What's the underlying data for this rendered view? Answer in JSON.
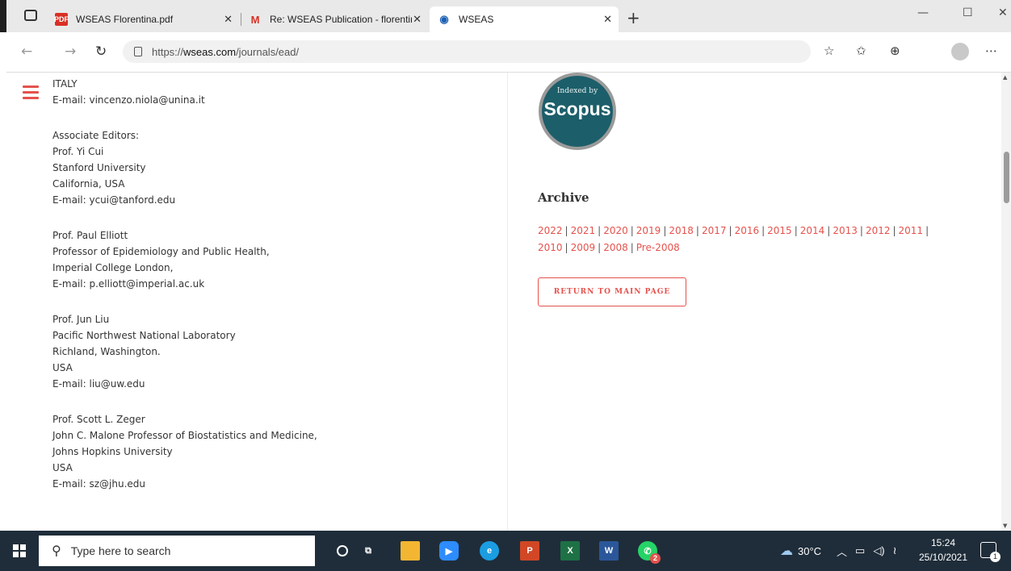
{
  "browser": {
    "tabs": [
      {
        "label": "WSEAS Florentina.pdf",
        "icon": "pdf-icon"
      },
      {
        "label": "Re: WSEAS Publication - florentir",
        "icon": "gmail-icon"
      },
      {
        "label": "WSEAS",
        "icon": "wseas-logo-icon"
      }
    ],
    "url_prefix": "https://",
    "url_domain": "wseas.com",
    "url_path": "/journals/ead/"
  },
  "left": {
    "lines_top": [
      "ITALY",
      "E-mail: vincenzo.niola@unina.it"
    ],
    "assoc_heading": "Associate Editors:",
    "block1": [
      "Prof. Yi Cui",
      "Stanford University",
      "California, USA",
      "E-mail: ycui@tanford.edu"
    ],
    "block2": [
      "Prof. Paul Elliott",
      "Professor of Epidemiology and Public Health,",
      "Imperial College London,",
      "E-mail: p.elliott@imperial.ac.uk"
    ],
    "block3": [
      "Prof. Jun Liu",
      "Pacific Northwest National Laboratory",
      "Richland, Washington.",
      "USA",
      "E-mail: liu@uw.edu"
    ],
    "block4": [
      "Prof. Scott L. Zeger",
      "John C. Malone Professor of Biostatistics and Medicine,",
      "Johns Hopkins University",
      "USA",
      "E-mail: sz@jhu.edu"
    ]
  },
  "right": {
    "scopus_small": "Indexed by",
    "scopus_big": "Scopus",
    "archive_title": "Archive",
    "years_row1": [
      "2022",
      "2021",
      "2020",
      "2019",
      "2018",
      "2017",
      "2016",
      "2015",
      "2014",
      "2013",
      "2012",
      "2011"
    ],
    "years_row2": [
      "2010",
      "2009",
      "2008",
      "Pre-2008"
    ],
    "return_label": "RETURN TO MAIN PAGE"
  },
  "taskbar": {
    "search_placeholder": "Type here to search",
    "weather": "30°C",
    "time": "15:24",
    "date": "25/10/2021",
    "notif_count": "1",
    "whatsapp_badge": "2"
  },
  "colors": {
    "accent": "#e5524d",
    "scopus_teal": "#1c5e6a",
    "taskbar": "#1f2d3a"
  }
}
